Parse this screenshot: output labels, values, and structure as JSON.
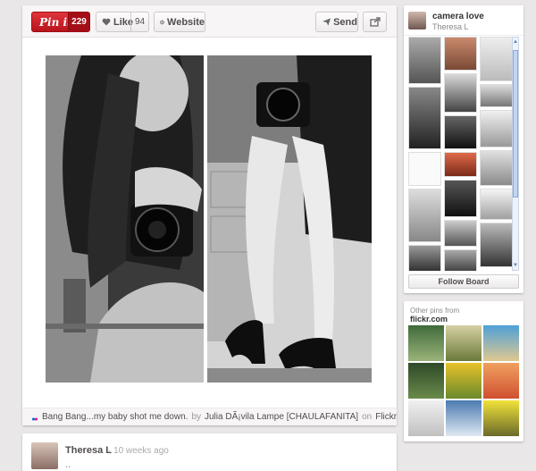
{
  "toolbar": {
    "pinit_label": "Pin it",
    "pinit_count": "229",
    "like_label": "Like",
    "like_count": "94",
    "website_label": "Website",
    "send_label": "Send"
  },
  "pin": {
    "description": "Bang Bang...my baby shot me down.",
    "by_word": "by",
    "author": "Julia DÃ¡vila Lampe [CHAULAFANITA]",
    "on_word": "on",
    "source": "Flickr"
  },
  "comment": {
    "name": "Theresa L",
    "time": "· 10 weeks ago",
    "text": ".."
  },
  "board": {
    "title": "camera love",
    "owner": "Theresa L",
    "follow_label": "Follow Board"
  },
  "other_pins": {
    "title": "Other pins from",
    "domain": "flickr.com"
  },
  "colors": {
    "pinit_red": "#cb2027",
    "background": "#e9e7e7"
  }
}
